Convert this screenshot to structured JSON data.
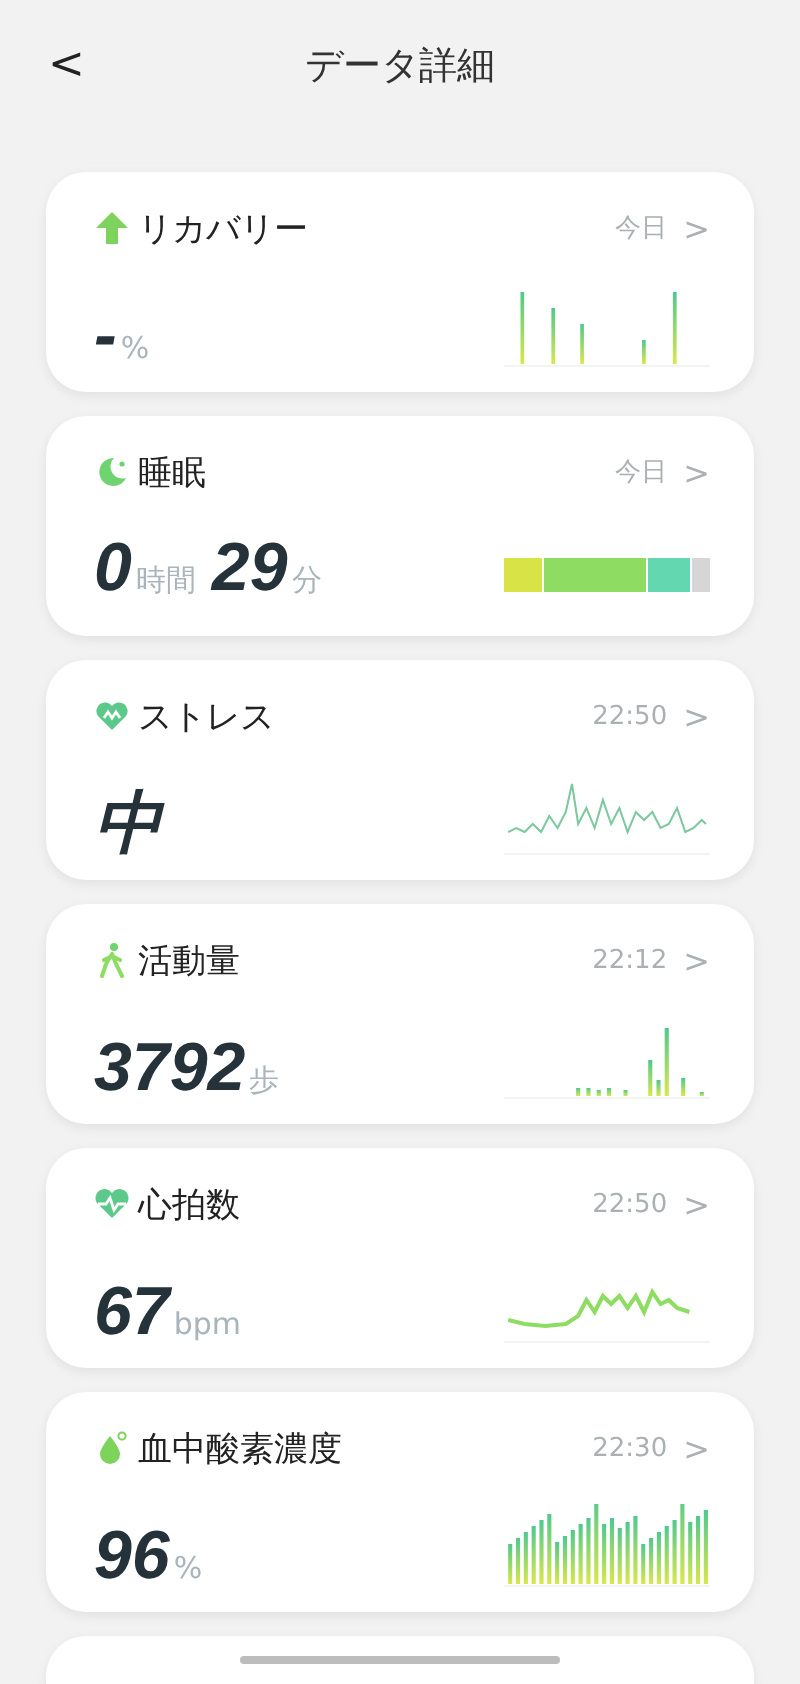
{
  "header": {
    "back": "<",
    "title": "データ詳細"
  },
  "cards": [
    {
      "kind": "recovery",
      "title": "リカバリー",
      "time": "今日",
      "chevron": ">",
      "value": [
        {
          "text": "-",
          "kind": "number"
        },
        {
          "text": "%",
          "kind": "unit"
        }
      ]
    },
    {
      "kind": "sleep",
      "title": "睡眠",
      "time": "今日",
      "chevron": ">",
      "value": [
        {
          "text": "0",
          "kind": "number"
        },
        {
          "text": "時間",
          "kind": "unit"
        },
        {
          "text": "29",
          "kind": "number"
        },
        {
          "text": "分",
          "kind": "unit"
        }
      ],
      "sleep_stages": [
        {
          "color": "#d8e346"
        },
        {
          "color": "#8edc62"
        },
        {
          "color": "#63d8b0"
        },
        {
          "color": "#d6d6d6"
        }
      ]
    },
    {
      "kind": "stress",
      "title": "ストレス",
      "time": "22:50",
      "chevron": ">",
      "value": [
        {
          "text": "中",
          "kind": "number"
        }
      ]
    },
    {
      "kind": "activity",
      "title": "活動量",
      "time": "22:12",
      "chevron": ">",
      "value": [
        {
          "text": "3792",
          "kind": "number"
        },
        {
          "text": "歩",
          "kind": "unit"
        }
      ]
    },
    {
      "kind": "heart",
      "title": "心拍数",
      "time": "22:50",
      "chevron": ">",
      "value": [
        {
          "text": "67",
          "kind": "number"
        },
        {
          "text": "bpm",
          "kind": "unit"
        }
      ]
    },
    {
      "kind": "spo2",
      "title": "血中酸素濃度",
      "time": "22:30",
      "chevron": ">",
      "value": [
        {
          "text": "96",
          "kind": "number"
        },
        {
          "text": "%",
          "kind": "unit"
        }
      ]
    }
  ]
}
